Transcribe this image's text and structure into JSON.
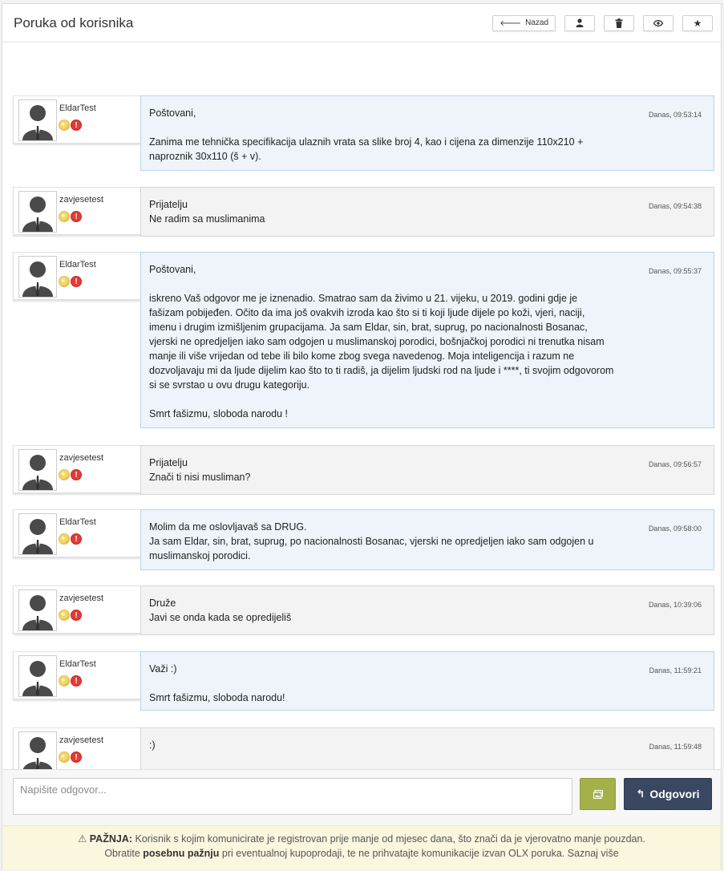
{
  "header": {
    "title": "Poruka od korisnika",
    "back_label": "Nazad",
    "back_icon": "arrow-left-icon",
    "profile_icon": "user-icon",
    "delete_icon": "trash-icon",
    "view_icon": "eye-icon",
    "favorite_icon": "star-icon"
  },
  "messages": [
    {
      "user": "EldarTest",
      "time": "Danas, 09:53:14",
      "text": "Poštovani,\n\nZanima me tehnička specifikacija ulaznih vrata sa slike broj 4, kao i cijena za dimenzije 110x210 + naproznik 30x110 (š + v).",
      "style": "blue"
    },
    {
      "user": "zavjesetest",
      "time": "Danas, 09:54:38",
      "text": "Prijatelju\nNe radim sa muslimanima",
      "style": "gray"
    },
    {
      "user": "EldarTest",
      "time": "Danas, 09:55:37",
      "text": "Poštovani,\n\niskreno Vaš odgovor me je iznenadio. Smatrao sam da živimo u 21. vijeku, u 2019. godini gdje je fašizam pobijeđen. Očito da ima još ovakvih izroda kao što si ti koji ljude dijele po koži, vjeri, naciji, imenu i drugim izmišljenim grupacijama. Ja sam Eldar, sin, brat, suprug, po nacionalnosti Bosanac, vjerski ne opredjeljen iako sam odgojen u muslimanskoj porodici, bošnjačkoj porodici ni trenutka nisam manje ili više vrijedan od tebe ili bilo kome zbog svega navedenog. Moja inteligencija i razum ne dozvoljavaju mi da ljude dijelim kao što to ti radiš, ja dijelim ljudski rod na ljude i ****, ti svojim odgovorom si se svrstao u ovu drugu kategoriju.\n\nSmrt fašizmu, sloboda narodu !",
      "style": "blue"
    },
    {
      "user": "zavjesetest",
      "time": "Danas, 09:56:57",
      "text": "Prijatelju\nZnači ti nisi musliman?",
      "style": "gray"
    },
    {
      "user": "EldarTest",
      "time": "Danas, 09:58:00",
      "text": "Molim da me oslovljavaš sa DRUG.\nJa sam Eldar, sin, brat, suprug, po nacionalnosti Bosanac, vjerski ne opredjeljen iako sam odgojen u muslimanskoj porodici.",
      "style": "blue"
    },
    {
      "user": "zavjesetest",
      "time": "Danas, 10:39:06",
      "text": "Druže\nJavi se onda kada se opredijeliš",
      "style": "gray"
    },
    {
      "user": "EldarTest",
      "time": "Danas, 11:59:21",
      "text": "Važi :)\n\nSmrt fašizmu, sloboda narodu!",
      "style": "blue"
    },
    {
      "user": "zavjesetest",
      "time": "Danas, 11:59:48",
      "text": ":)",
      "style": "gray"
    }
  ],
  "reply": {
    "placeholder": "Napišite odgovor...",
    "send_label": "Odgovori",
    "send_icon": "reply-arrow-icon",
    "attach_icon": "attach-image-icon"
  },
  "warning": {
    "label": "PAŽNJA:",
    "line1": "Korisnik s kojim komunicirate je registrovan prije manje od mjesec dana, što znači da je vjerovatno manje pouzdan.",
    "line2_pre": "Obratite",
    "line2_bold": "posebnu pažnju",
    "line2_post": "pri eventualnoj kupoprodaji, te ne prihvatajte komunikacije izvan OLX poruka.",
    "link": "Saznaj više"
  },
  "colors": {
    "blue_bubble": "#eef4f9",
    "gray_bubble": "#f3f3f3",
    "send_button": "#3a4760",
    "attach_button": "#a4b04a",
    "warning_bg": "#fbf7df"
  }
}
